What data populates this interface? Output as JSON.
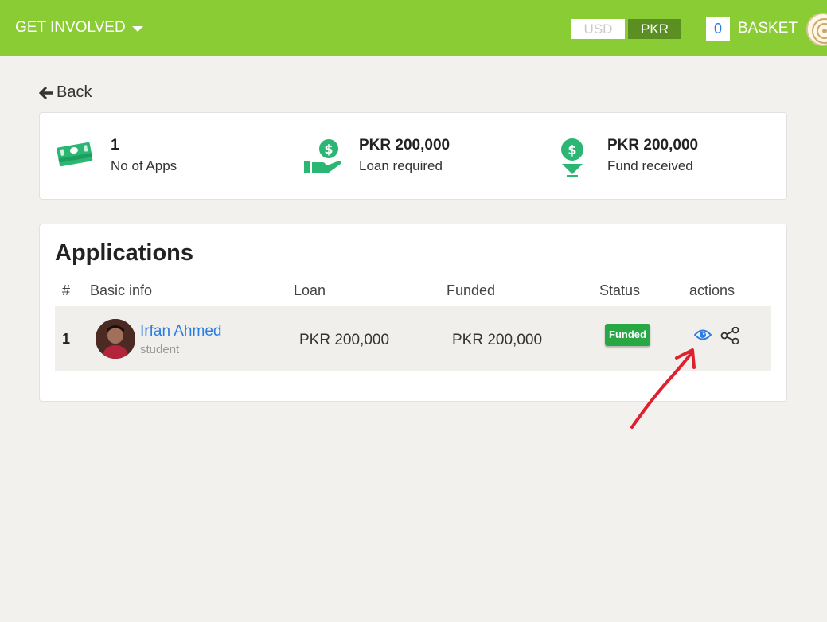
{
  "header": {
    "menu_label": "GET INVOLVED",
    "currency_options": [
      "USD",
      "PKR"
    ],
    "selected_currency": "PKR",
    "basket_count": "0",
    "basket_label": "BASKET"
  },
  "nav": {
    "back_label": "Back"
  },
  "stats": [
    {
      "value": "1",
      "label": "No of Apps",
      "icon": "money-stack-icon"
    },
    {
      "value": "PKR 200,000",
      "label": "Loan required",
      "icon": "hand-dollar-icon"
    },
    {
      "value": "PKR 200,000",
      "label": "Fund received",
      "icon": "dollar-down-icon"
    }
  ],
  "applications": {
    "title": "Applications",
    "columns": [
      "#",
      "Basic info",
      "Loan",
      "Funded",
      "Status",
      "actions"
    ],
    "rows": [
      {
        "num": "1",
        "name": "Irfan Ahmed",
        "role": "student",
        "loan": "PKR 200,000",
        "funded": "PKR 200,000",
        "status": "Funded"
      }
    ]
  },
  "colors": {
    "topbar": "#8acc33",
    "selected_currency_bg": "#5b8f22",
    "stat_icon": "#2bb673",
    "link": "#2c7de0",
    "badge": "#28a745",
    "annotation_arrow": "#e0202f"
  }
}
